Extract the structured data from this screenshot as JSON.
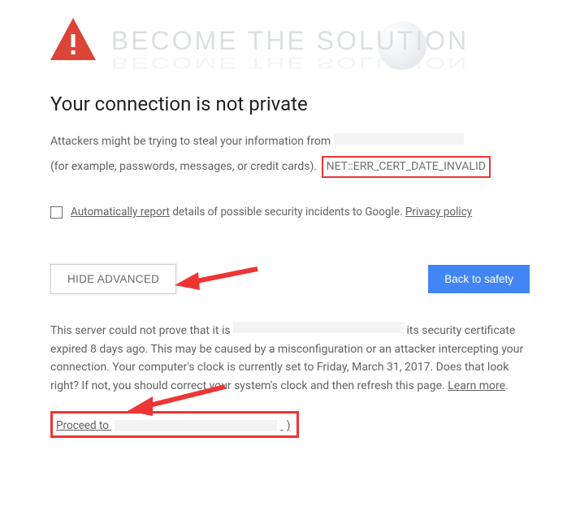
{
  "watermark": {
    "text": "Become The Solution"
  },
  "heading": "Your connection is not private",
  "description_prefix": "Attackers might be trying to steal your information from ",
  "description_line2_prefix": "(for example, passwords, messages, or credit cards).",
  "error_code": "NET::ERR_CERT_DATE_INVALID",
  "report_prefix": "Automatically report",
  "report_rest": " details of possible security incidents to Google. ",
  "privacy_link": "Privacy policy",
  "btn_advanced": "HIDE ADVANCED",
  "btn_safety": "Back to safety",
  "explain_a": "This server could not prove that it is ",
  "explain_b": " its security certificate expired 8 days ago. This may be caused by a misconfiguration or an attacker intercepting your connection. Your computer's clock is currently set to Friday, March 31, 2017. Does that look right? If not, you should correct your system's clock and then refresh this page. ",
  "learn_more": "Learn more",
  "proceed_label": "Proceed to",
  "proceed_tail": ")"
}
